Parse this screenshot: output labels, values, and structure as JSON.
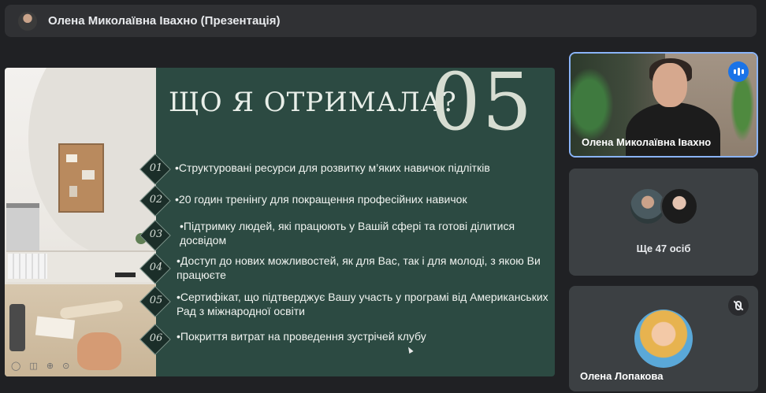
{
  "topbar": {
    "presenter_title": "Олена Миколаївна Івахно (Презентація)"
  },
  "slide": {
    "title": "ЩО Я ОТРИМАЛА?",
    "number": "05",
    "items": [
      {
        "num": "01",
        "text": "•Структуровані ресурси для розвитку м’яких навичок підлітків"
      },
      {
        "num": "02",
        "text": "•20 годин тренінгу для покращення професійних навичок"
      },
      {
        "num": "03",
        "text": "•Підтримку людей, які працюють у Вашій сфері та готові ділитися досвідом"
      },
      {
        "num": "04",
        "text": "•Доступ до нових можливостей, як для Вас, так і для молоді, з якою Ви працюєте"
      },
      {
        "num": "05",
        "text": "•Сертифікат, що підтверджує Вашу участь у програмі від Американських Рад з міжнародної освіти"
      },
      {
        "num": "06",
        "text": "•Покриття витрат на проведення зустрічей клубу"
      }
    ],
    "photo_toolbar": "◯ ◫ ⊕ ⊙"
  },
  "tiles": {
    "speaker_name": "Олена Миколаївна Івахно",
    "others_label": "Ще 47 осіб",
    "participant_name": "Олена Лопакова"
  },
  "colors": {
    "background": "#202124",
    "slide_green": "#2c4a42",
    "active_border": "#8ab4f8",
    "speaking_badge": "#1a73e8"
  }
}
